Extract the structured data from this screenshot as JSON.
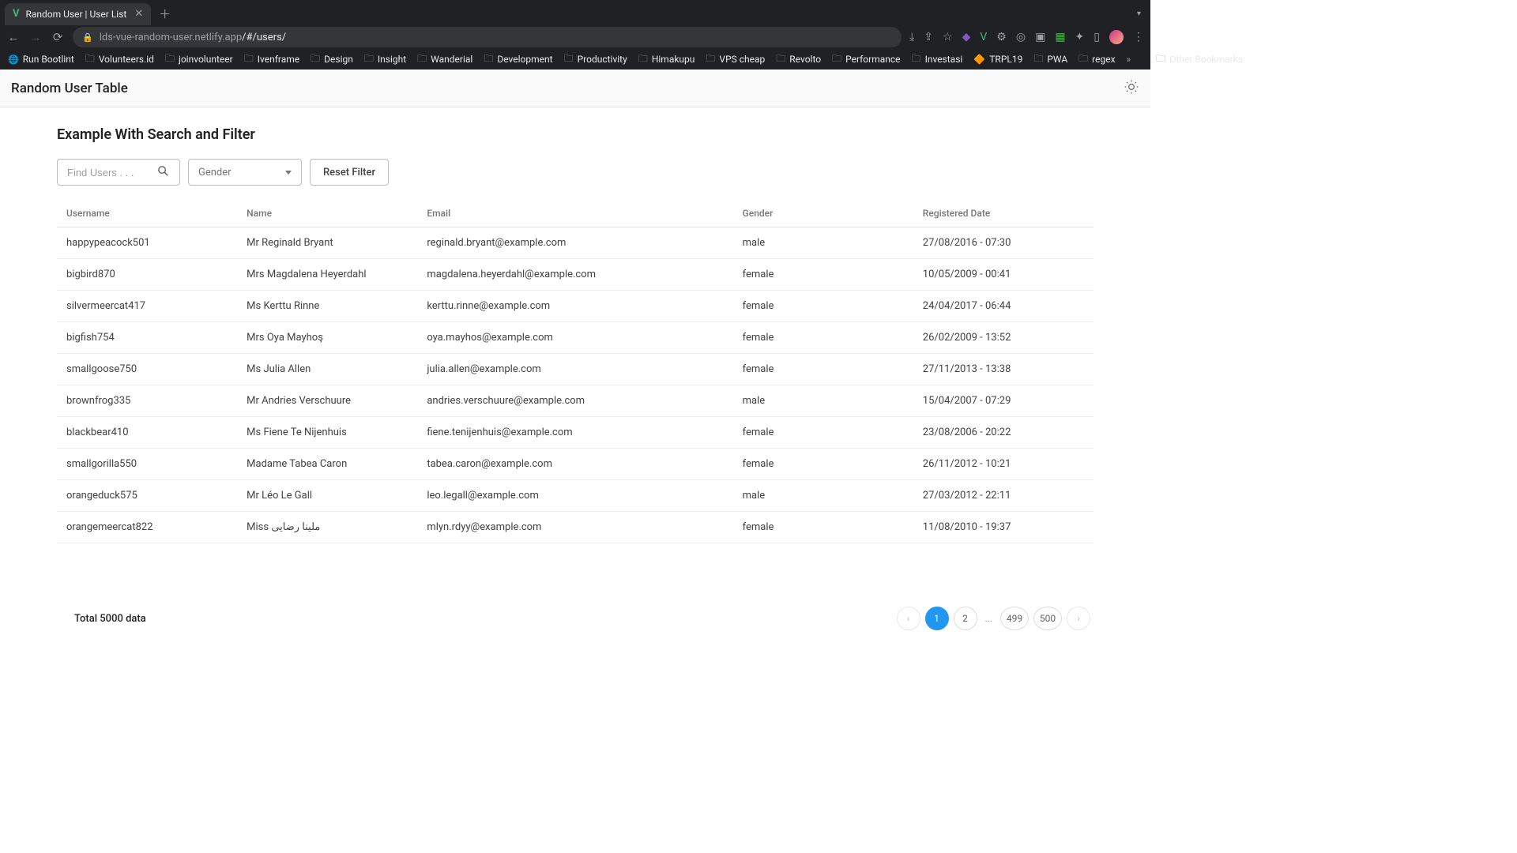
{
  "browser": {
    "tab_title": "Random User | User List",
    "url_host": "lds-vue-random-user.netlify.app",
    "url_path": "/#/users/",
    "bookmarks": [
      "Run Bootlint",
      "Volunteers.id",
      "joinvolunteer",
      "Ivenframe",
      "Design",
      "Insight",
      "Wanderial",
      "Development",
      "Productivity",
      "Himakupu",
      "VPS cheap",
      "Revolto",
      "Performance",
      "Investasi",
      "TRPL19",
      "PWA",
      "regex"
    ],
    "other_bookmarks": "Other Bookmarks"
  },
  "page": {
    "app_title": "Random User Table",
    "section_title": "Example With Search and Filter",
    "search_placeholder": "Find Users . . .",
    "gender_placeholder": "Gender",
    "reset_label": "Reset Filter",
    "columns": {
      "username": "Username",
      "name": "Name",
      "email": "Email",
      "gender": "Gender",
      "date": "Registered Date"
    },
    "rows": [
      {
        "username": "happypeacock501",
        "name": "Mr Reginald Bryant",
        "email": "reginald.bryant@example.com",
        "gender": "male",
        "date": "27/08/2016 - 07:30"
      },
      {
        "username": "bigbird870",
        "name": "Mrs Magdalena Heyerdahl",
        "email": "magdalena.heyerdahl@example.com",
        "gender": "female",
        "date": "10/05/2009 - 00:41"
      },
      {
        "username": "silvermeercat417",
        "name": "Ms Kerttu Rinne",
        "email": "kerttu.rinne@example.com",
        "gender": "female",
        "date": "24/04/2017 - 06:44"
      },
      {
        "username": "bigfish754",
        "name": "Mrs Oya Mayhoş",
        "email": "oya.mayhos@example.com",
        "gender": "female",
        "date": "26/02/2009 - 13:52"
      },
      {
        "username": "smallgoose750",
        "name": "Ms Julia Allen",
        "email": "julia.allen@example.com",
        "gender": "female",
        "date": "27/11/2013 - 13:38"
      },
      {
        "username": "brownfrog335",
        "name": "Mr Andries Verschuure",
        "email": "andries.verschuure@example.com",
        "gender": "male",
        "date": "15/04/2007 - 07:29"
      },
      {
        "username": "blackbear410",
        "name": "Ms Fiene Te Nijenhuis",
        "email": "fiene.tenijenhuis@example.com",
        "gender": "female",
        "date": "23/08/2006 - 20:22"
      },
      {
        "username": "smallgorilla550",
        "name": "Madame Tabea Caron",
        "email": "tabea.caron@example.com",
        "gender": "female",
        "date": "26/11/2012 - 10:21"
      },
      {
        "username": "orangeduck575",
        "name": "Mr Léo Le Gall",
        "email": "leo.legall@example.com",
        "gender": "male",
        "date": "27/03/2012 - 22:11"
      },
      {
        "username": "orangemeercat822",
        "name": "Miss ملینا رضایی",
        "email": "mlyn.rdyy@example.com",
        "gender": "female",
        "date": "11/08/2010 - 19:37"
      }
    ],
    "total_label": "Total 5000 data",
    "pagination": {
      "current": "1",
      "p2": "2",
      "p499": "499",
      "p500": "500",
      "ellipsis": "..."
    }
  }
}
